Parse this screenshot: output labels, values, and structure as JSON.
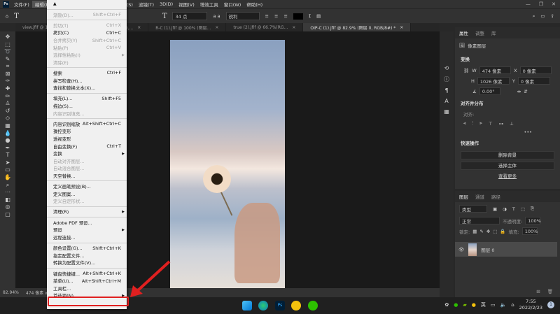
{
  "menubar": {
    "items": [
      "文件(F)",
      "编辑(E)",
      "图像(I)",
      "图层(L)",
      "文字(Y)",
      "选择(S)",
      "滤镜(T)",
      "3D(D)",
      "视图(V)",
      "增效工具",
      "窗口(W)",
      "帮助(H)"
    ]
  },
  "window_controls": [
    "—",
    "❐",
    "✕"
  ],
  "options": {
    "font_size": "34 点",
    "aa_label": "a a",
    "aa_value": "锐利"
  },
  "tabs": [
    "view.jfif @ 10...",
    "true.jfif @ 75.7% (图层 0,...",
    "R-C (1).jfif @ 100% (图层...",
    "true (2).jfif @ 66.7%(RG...",
    "OIP-C (1).jfif @ 82.9% (图层 0, RGB/8#) *"
  ],
  "status": {
    "zoom": "82.94%",
    "info": "474 像素 x 1026 像素"
  },
  "edit_menu": [
    {
      "type": "top",
      "label": "▲"
    },
    {
      "type": "sep"
    },
    {
      "label": "渐隐(D)...",
      "shortcut": "Shift+Ctrl+F",
      "disabled": true
    },
    {
      "type": "sep"
    },
    {
      "label": "剪切(T)",
      "shortcut": "Ctrl+X",
      "disabled": true
    },
    {
      "label": "拷贝(C)",
      "shortcut": "Ctrl+C"
    },
    {
      "label": "合并拷贝(Y)",
      "shortcut": "Shift+Ctrl+C",
      "disabled": true
    },
    {
      "label": "粘贴(P)",
      "shortcut": "Ctrl+V",
      "disabled": true
    },
    {
      "label": "选择性粘贴(I)",
      "submenu": true,
      "disabled": true
    },
    {
      "label": "清除(E)",
      "disabled": true
    },
    {
      "type": "sep"
    },
    {
      "label": "搜索",
      "shortcut": "Ctrl+F"
    },
    {
      "label": "拼写检查(H)..."
    },
    {
      "label": "查找和替换文本(X)..."
    },
    {
      "type": "sep"
    },
    {
      "label": "填充(L)...",
      "shortcut": "Shift+F5"
    },
    {
      "label": "描边(S)..."
    },
    {
      "label": "内容识别填充...",
      "disabled": true
    },
    {
      "type": "sep"
    },
    {
      "label": "内容识别缩放",
      "shortcut": "Alt+Shift+Ctrl+C"
    },
    {
      "label": "操控变形"
    },
    {
      "label": "透视变形"
    },
    {
      "label": "自由变换(F)",
      "shortcut": "Ctrl+T"
    },
    {
      "label": "变换",
      "submenu": true
    },
    {
      "label": "自动对齐图层...",
      "disabled": true
    },
    {
      "label": "自动混合图层...",
      "disabled": true
    },
    {
      "label": "天空替换..."
    },
    {
      "type": "sep"
    },
    {
      "label": "定义画笔预设(B)..."
    },
    {
      "label": "定义图案..."
    },
    {
      "label": "定义自定形状...",
      "disabled": true
    },
    {
      "type": "sep"
    },
    {
      "label": "清理(R)",
      "submenu": true
    },
    {
      "type": "sep"
    },
    {
      "label": "Adobe PDF 预设..."
    },
    {
      "label": "预设",
      "submenu": true
    },
    {
      "label": "远程连接..."
    },
    {
      "type": "sep"
    },
    {
      "label": "颜色设置(G)...",
      "shortcut": "Shift+Ctrl+K"
    },
    {
      "label": "指定配置文件..."
    },
    {
      "label": "转换为配置文件(V)..."
    },
    {
      "type": "sep"
    },
    {
      "label": "键盘快捷键...",
      "shortcut": "Alt+Shift+Ctrl+K"
    },
    {
      "label": "菜单(U)...",
      "shortcut": "Alt+Shift+Ctrl+M"
    },
    {
      "label": "工具栏..."
    },
    {
      "label": "首选项(N)",
      "submenu": true,
      "highlighted": true
    }
  ],
  "properties": {
    "tabs": [
      "属性",
      "调整",
      "库"
    ],
    "layer_type": "像素图层",
    "transform_title": "变换",
    "w_label": "W",
    "w_value": "474 像素",
    "h_label": "H",
    "h_value": "1026 像素",
    "x_label": "X",
    "x_value": "0 像素",
    "y_label": "Y",
    "y_value": "0 像素",
    "angle": "0.00°",
    "align_title": "对齐并分布",
    "align_label": "对齐:",
    "more": "•••",
    "quick_title": "快速操作",
    "remove_bg": "删除背景",
    "select_subject": "选择主体",
    "view_more": "查看更多"
  },
  "layers": {
    "tabs": [
      "图层",
      "通道",
      "路径"
    ],
    "filter": "类型",
    "blend": "正常",
    "opacity_label": "不透明度:",
    "opacity": "100%",
    "lock_label": "锁定:",
    "fill_label": "填充:",
    "fill": "100%",
    "layer_name": "图层 0"
  },
  "taskbar": {
    "ime": "英",
    "time": "7:55",
    "date": "2022/2/23",
    "notif": "1"
  },
  "colors": {
    "highlight": "#e02020",
    "ps_blue": "#31a8ff"
  }
}
